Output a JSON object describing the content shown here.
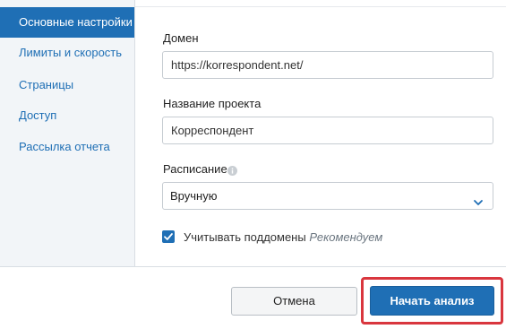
{
  "sidebar": {
    "items": [
      {
        "label": "Основные настройки",
        "active": true
      },
      {
        "label": "Лимиты и скорость",
        "active": false
      },
      {
        "label": "Страницы",
        "active": false
      },
      {
        "label": "Доступ",
        "active": false
      },
      {
        "label": "Рассылка отчета",
        "active": false
      }
    ]
  },
  "form": {
    "domain": {
      "label": "Домен",
      "value": "https://korrespondent.net/"
    },
    "project_name": {
      "label": "Название проекта",
      "value": "Корреспондент"
    },
    "schedule": {
      "label": "Расписание",
      "selected": "Вручную",
      "info_icon": "info-icon"
    },
    "subdomains": {
      "label": "Учитывать поддомены",
      "hint": "Рекомендуем",
      "checked": true
    }
  },
  "footer": {
    "cancel_label": "Отмена",
    "start_label": "Начать анализ"
  },
  "colors": {
    "accent": "#1f6fb5",
    "highlight": "#d9363e",
    "sidebar_bg": "#f2f5f8"
  }
}
